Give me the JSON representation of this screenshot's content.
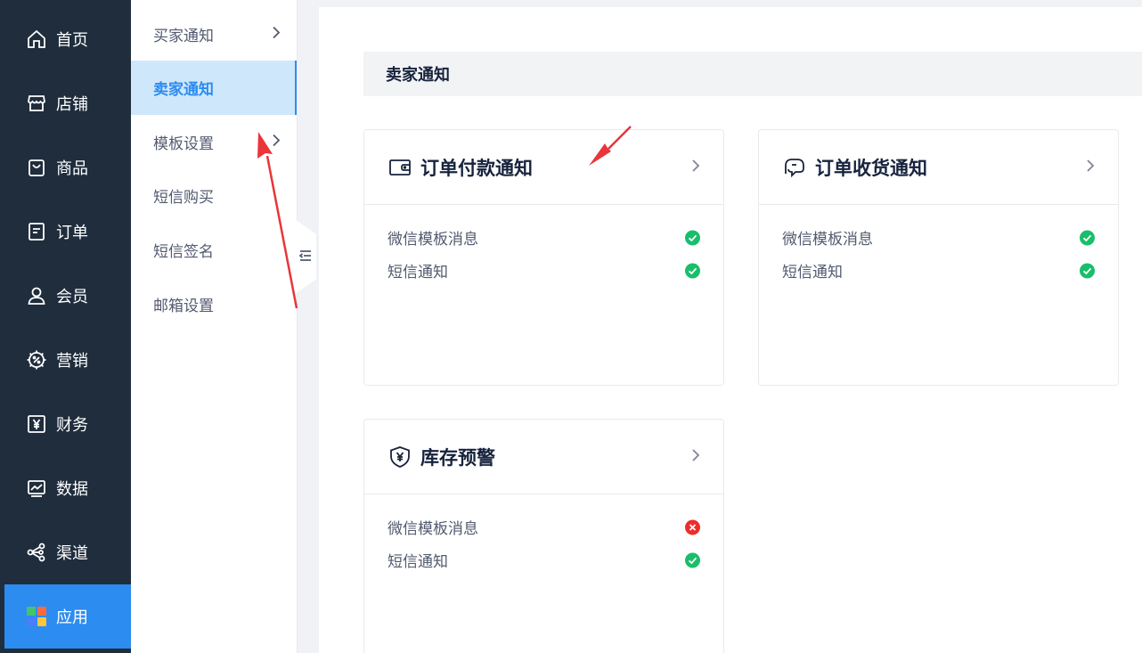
{
  "main_nav": [
    {
      "label": "首页",
      "icon": "home-icon"
    },
    {
      "label": "店铺",
      "icon": "store-icon"
    },
    {
      "label": "商品",
      "icon": "bag-icon"
    },
    {
      "label": "订单",
      "icon": "order-icon"
    },
    {
      "label": "会员",
      "icon": "user-icon"
    },
    {
      "label": "营销",
      "icon": "marketing-gear-icon"
    },
    {
      "label": "财务",
      "icon": "finance-yen-icon"
    },
    {
      "label": "数据",
      "icon": "chart-icon"
    },
    {
      "label": "渠道",
      "icon": "share-icon"
    },
    {
      "label": "应用",
      "icon": "apps-icon",
      "active": true
    }
  ],
  "sub_nav": [
    {
      "label": "买家通知",
      "has_children": true
    },
    {
      "label": "卖家通知",
      "active": true
    },
    {
      "label": "模板设置",
      "has_children": true
    },
    {
      "label": "短信购买"
    },
    {
      "label": "短信签名"
    },
    {
      "label": "邮箱设置"
    }
  ],
  "section": {
    "title": "卖家通知"
  },
  "cards": [
    {
      "title": "订单付款通知",
      "icon": "wallet-icon",
      "rows": [
        {
          "label": "微信模板消息",
          "status": "enabled"
        },
        {
          "label": "短信通知",
          "status": "enabled"
        }
      ]
    },
    {
      "title": "订单收货通知",
      "icon": "receipt-icon",
      "rows": [
        {
          "label": "微信模板消息",
          "status": "enabled"
        },
        {
          "label": "短信通知",
          "status": "enabled"
        }
      ]
    },
    {
      "title": "库存预警",
      "icon": "shield-yen-icon",
      "rows": [
        {
          "label": "微信模板消息",
          "status": "disabled"
        },
        {
          "label": "短信通知",
          "status": "enabled"
        }
      ]
    }
  ],
  "colors": {
    "nav_bg": "#1f2d3d",
    "accent": "#2d8cf0",
    "enabled": "#19be6b",
    "disabled": "#ed2d2d",
    "annotation": "#e8363a"
  }
}
